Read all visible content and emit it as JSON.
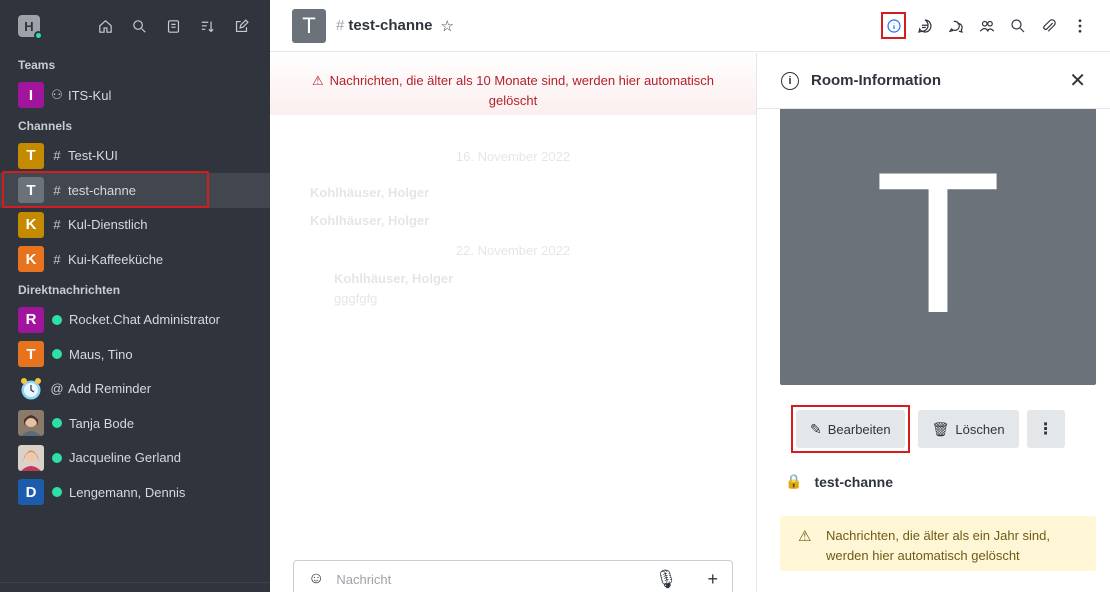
{
  "sidebar": {
    "workspace_initial": "H",
    "sections": {
      "teams": "Teams",
      "channels": "Channels",
      "dms": "Direktnachrichten"
    },
    "teams": [
      {
        "initial": "I",
        "label": "ITS-Kul",
        "color": "#a1159d"
      }
    ],
    "channels": [
      {
        "initial": "T",
        "label": "Test-KUI",
        "color": "#c48a00"
      },
      {
        "initial": "T",
        "label": "test-channe",
        "color": "#6c727a"
      },
      {
        "initial": "K",
        "label": "Kul-Dienstlich",
        "color": "#c48a00"
      },
      {
        "initial": "K",
        "label": "Kui-Kaffeeküche",
        "color": "#e8731f"
      }
    ],
    "dms": [
      {
        "initial": "R",
        "label": "Rocket.Chat Administrator",
        "color": "#a1159d"
      },
      {
        "initial": "T",
        "label": "Maus, Tino",
        "color": "#e8731f"
      },
      {
        "initial": "",
        "label": "Add Reminder",
        "prefix": "@"
      },
      {
        "initial": "",
        "label": "Tanja Bode"
      },
      {
        "initial": "",
        "label": "Jacqueline Gerland"
      },
      {
        "initial": "D",
        "label": "Lengemann, Dennis",
        "color": "#1d5cad"
      }
    ]
  },
  "header": {
    "room_initial": "T",
    "room_name": "test-channe"
  },
  "messages": {
    "retention": "Nachrichten, die älter als 10 Monate sind, werden hier automatisch gelöscht",
    "composer_placeholder": "Nachricht",
    "faded": {
      "d1": "16. November 2022",
      "u1": "Kohlhäuser, Holger",
      "u2": "Kohlhäuser, Holger",
      "d2": "22. November 2022",
      "u3": "Kohlhäuser, Holger",
      "msg": "gggfgfg"
    }
  },
  "panel": {
    "title": "Room-Information",
    "image_initial": "T",
    "edit_label": "Bearbeiten",
    "delete_label": "Löschen",
    "room_name": "test-channe",
    "retention": "Nachrichten, die älter als ein Jahr sind, werden hier automatisch gelöscht"
  },
  "colors": {
    "sidebar_bg": "#2f343d",
    "online": "#2de0a5",
    "highlight": "#d21e1e",
    "danger_text": "#b5202b"
  }
}
